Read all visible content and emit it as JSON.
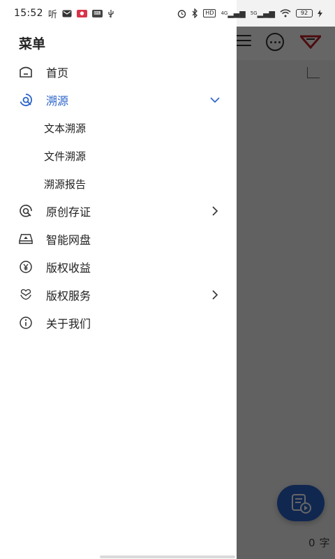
{
  "status_bar": {
    "time": "15:52",
    "app_label": "听",
    "network_4g": "4G",
    "network_5g": "5G",
    "hd_label": "HD",
    "battery": "92"
  },
  "drawer": {
    "title": "菜单",
    "items": [
      {
        "label": "首页",
        "icon": "home-icon"
      },
      {
        "label": "溯源",
        "icon": "trace-icon",
        "active": true,
        "expanded": true
      },
      {
        "label": "原创存证",
        "icon": "original-cert-icon"
      },
      {
        "label": "智能网盘",
        "icon": "cloud-drive-icon"
      },
      {
        "label": "版权收益",
        "icon": "yuan-icon"
      },
      {
        "label": "版权服务",
        "icon": "heart-service-icon"
      },
      {
        "label": "关于我们",
        "icon": "info-icon"
      }
    ],
    "sub_items": [
      {
        "label": "文本溯源"
      },
      {
        "label": "文件溯源"
      },
      {
        "label": "溯源报告"
      }
    ]
  },
  "background": {
    "word_count_value": "0",
    "word_count_unit": "字"
  },
  "colors": {
    "accent": "#2a63c9",
    "text": "#222222",
    "scrim": "#000000"
  }
}
